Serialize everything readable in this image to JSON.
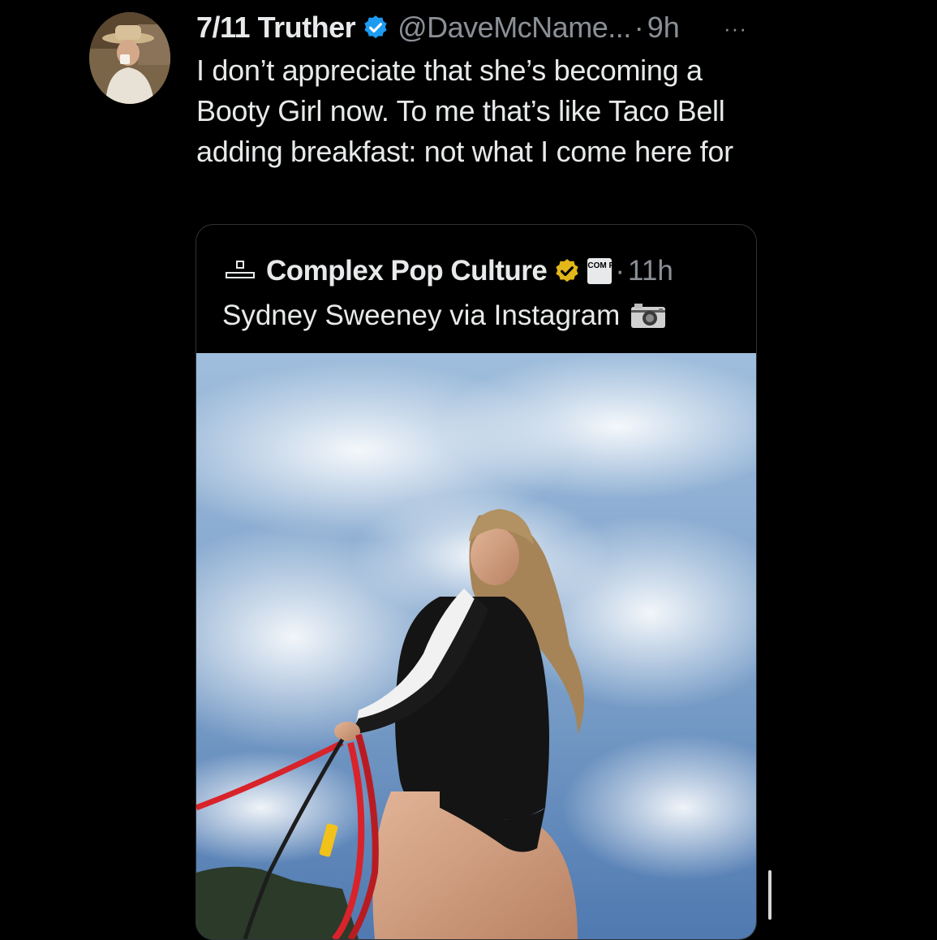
{
  "tweet": {
    "display_name": "7/11 Truther",
    "handle": "@DaveMcName...",
    "separator": "·",
    "time": "9h",
    "more": "···",
    "text": "I don’t appreciate that she’s becoming a Booty Girl now. To me that’s like Taco Bell adding breakfast: not what I come here for",
    "verified_color": "#1d9bf0",
    "avatar_icon": "profile-photo-cowboy-hat"
  },
  "quote": {
    "display_name": "Complex Pop Culture",
    "affiliate_badge": "COM PLEX",
    "separator": "·",
    "time": "11h",
    "text": "Sydney Sweeney via Instagram",
    "text_icon": "camera-emoji",
    "verified_color": "#e2b719",
    "avatar_icon": "pop-culture-logo"
  },
  "colors": {
    "background": "#000000",
    "primary_text": "#e7e9ea",
    "secondary_text": "#8b9096",
    "border": "#2f3336"
  }
}
